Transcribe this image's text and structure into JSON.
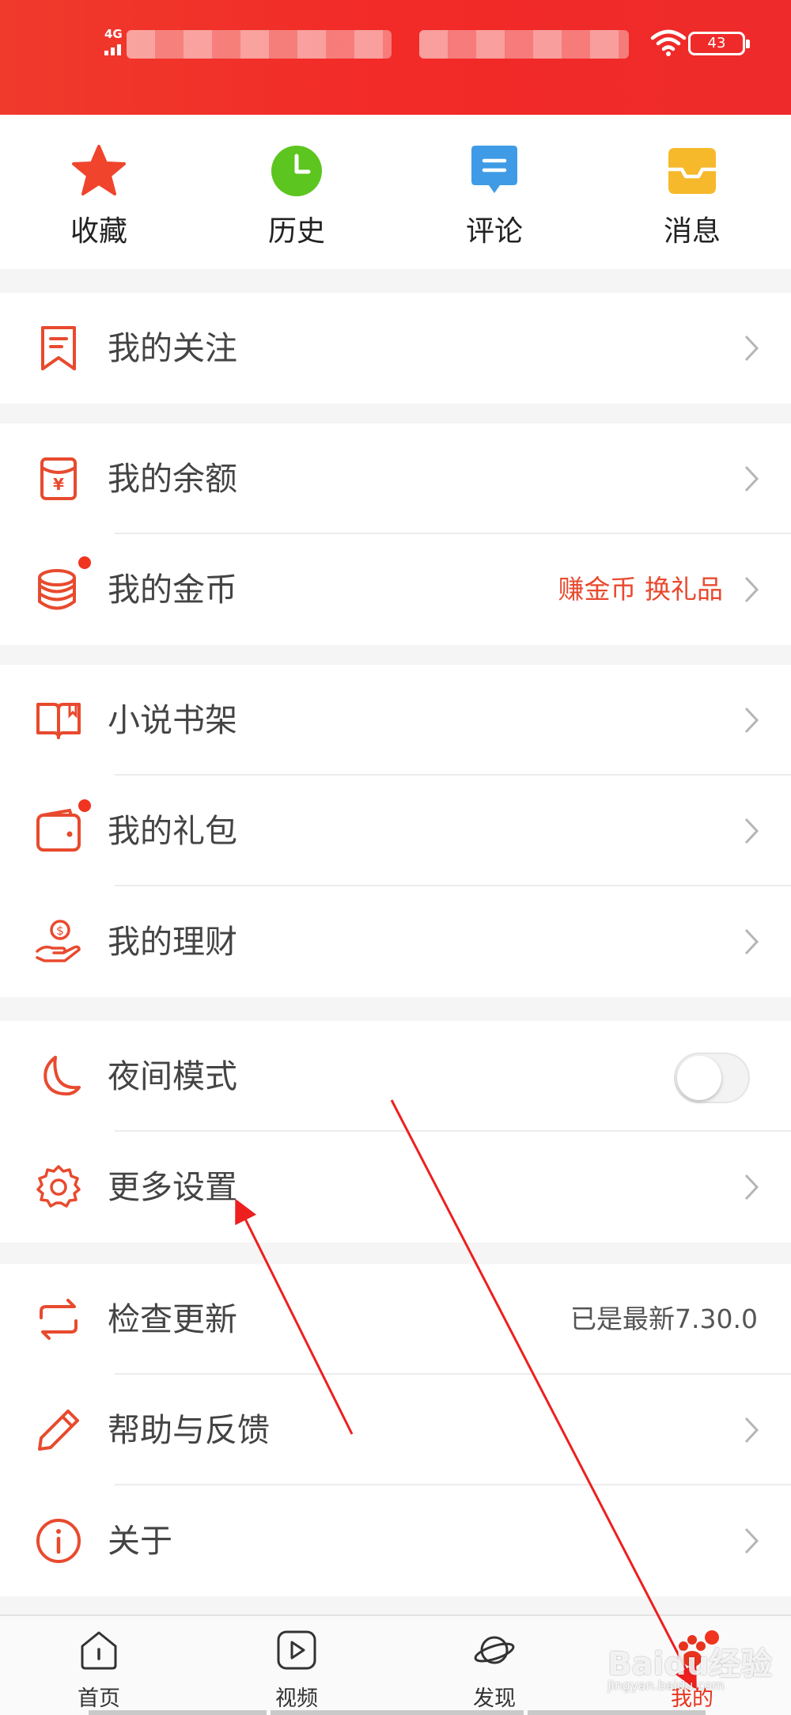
{
  "status_bar": {
    "network": "4G",
    "battery": "43"
  },
  "quick_actions": [
    {
      "label": "收藏",
      "icon": "star-icon",
      "color": "#f0442c"
    },
    {
      "label": "历史",
      "icon": "clock-icon",
      "color": "#5cc51f"
    },
    {
      "label": "评论",
      "icon": "comment-icon",
      "color": "#3f9be6"
    },
    {
      "label": "消息",
      "icon": "inbox-icon",
      "color": "#f6b92b"
    }
  ],
  "menu": {
    "follow": {
      "label": "我的关注",
      "icon": "bookmark-icon"
    },
    "balance": {
      "label": "我的余额",
      "icon": "yuan-wallet-icon"
    },
    "coins": {
      "label": "我的金币",
      "icon": "coins-icon",
      "right_text": "赚金币 换礼品",
      "has_dot": true
    },
    "bookshelf": {
      "label": "小说书架",
      "icon": "book-icon"
    },
    "gift": {
      "label": "我的礼包",
      "icon": "wallet-icon",
      "has_dot": true
    },
    "finance": {
      "label": "我的理财",
      "icon": "money-hand-icon"
    },
    "night": {
      "label": "夜间模式",
      "icon": "moon-icon",
      "toggle_on": false
    },
    "settings": {
      "label": "更多设置",
      "icon": "gear-icon"
    },
    "update": {
      "label": "检查更新",
      "icon": "refresh-icon",
      "right_text": "已是最新7.30.0"
    },
    "help": {
      "label": "帮助与反馈",
      "icon": "pencil-icon"
    },
    "about": {
      "label": "关于",
      "icon": "info-icon"
    }
  },
  "tab_bar": [
    {
      "label": "首页",
      "icon": "home-icon"
    },
    {
      "label": "视频",
      "icon": "video-icon"
    },
    {
      "label": "发现",
      "icon": "planet-icon"
    },
    {
      "label": "我的",
      "icon": "paw-icon",
      "active": true
    }
  ],
  "accent_color": "#e84a2e",
  "watermark": {
    "brand": "Baidu经验",
    "url": "jingyan.baidu.com"
  }
}
